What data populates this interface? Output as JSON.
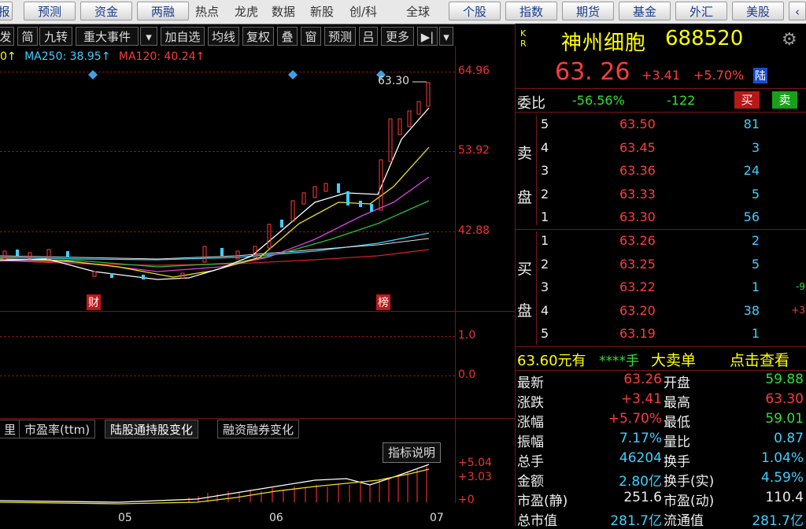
{
  "nav": {
    "left_buttons": [
      "报",
      "预测",
      "资金",
      "两融"
    ],
    "texts": [
      "热点",
      "龙虎",
      "数据",
      "新股",
      "创/科",
      "全球"
    ],
    "right_buttons": [
      "个股",
      "指数",
      "期货",
      "基金",
      "外汇",
      "美股"
    ]
  },
  "chart_toolbar": [
    "发",
    "简",
    "九转",
    "重大事件",
    "加自选",
    "均线",
    "复权",
    "叠",
    "窗",
    "预测",
    "吕",
    "更多"
  ],
  "ma_legend": {
    "prefix": "0↑",
    "ma250": "MA250: 38.95↑",
    "ma120": "MA120: 40.24↑"
  },
  "price_axis": [
    "64.96",
    "53.92",
    "42.88"
  ],
  "max_label": "63.30",
  "markers": {
    "cai": "财",
    "bang": "榜"
  },
  "indicator_axis": [
    "1.0",
    "0.0"
  ],
  "tabs": [
    "里",
    "市盈率(ttm)",
    "陆股通持股变化",
    "融资融券变化"
  ],
  "sub_button": "指标说明",
  "sub_axis": [
    "+5.04",
    "+3.03",
    "+0"
  ],
  "time_axis": [
    "05",
    "06",
    "07"
  ],
  "stock": {
    "kr": "K\nR",
    "name": "神州细胞",
    "code": "688520",
    "price": "63. 26",
    "change": "+3.41",
    "change_pct": "+5.70%",
    "lu": "陆"
  },
  "weibi": {
    "label": "委比",
    "pct": "-56.56%",
    "val": "-122",
    "buy_btn": "买",
    "sell_btn": "卖"
  },
  "sell_label": [
    "卖",
    "盘"
  ],
  "buy_label": [
    "买",
    "盘"
  ],
  "sell_orders": [
    {
      "lvl": "5",
      "price": "63.50",
      "vol": "81",
      "chg": ""
    },
    {
      "lvl": "4",
      "price": "63.45",
      "vol": "3",
      "chg": ""
    },
    {
      "lvl": "3",
      "price": "63.36",
      "vol": "24",
      "chg": ""
    },
    {
      "lvl": "2",
      "price": "63.33",
      "vol": "5",
      "chg": ""
    },
    {
      "lvl": "1",
      "price": "63.30",
      "vol": "56",
      "chg": ""
    }
  ],
  "buy_orders": [
    {
      "lvl": "1",
      "price": "63.26",
      "vol": "2",
      "chg": ""
    },
    {
      "lvl": "2",
      "price": "63.25",
      "vol": "5",
      "chg": ""
    },
    {
      "lvl": "3",
      "price": "63.22",
      "vol": "1",
      "chg": "-9"
    },
    {
      "lvl": "4",
      "price": "63.20",
      "vol": "38",
      "chg": "+3"
    },
    {
      "lvl": "5",
      "price": "63.19",
      "vol": "1",
      "chg": ""
    }
  ],
  "big_order": {
    "price": "63.60元有",
    "stars": "****手",
    "label": "大卖单",
    "link": "点击查看"
  },
  "stats": [
    {
      "l1": "最新",
      "v1": "63.26",
      "l2": "开盘",
      "v2": "59.88",
      "c1": "red",
      "c2": "grn"
    },
    {
      "l1": "涨跌",
      "v1": "+3.41",
      "l2": "最高",
      "v2": "63.30",
      "c1": "red",
      "c2": "red"
    },
    {
      "l1": "涨幅",
      "v1": "+5.70%",
      "l2": "最低",
      "v2": "59.01",
      "c1": "red",
      "c2": "grn"
    },
    {
      "l1": "振幅",
      "v1": "7.17%",
      "l2": "量比",
      "v2": "0.87",
      "c1": "cyan",
      "c2": "cyan"
    },
    {
      "l1": "总手",
      "v1": "46204",
      "l2": "换手",
      "v2": "1.04%",
      "c1": "cyan",
      "c2": "cyan"
    },
    {
      "l1": "金额",
      "v1": "2.80亿",
      "l2": "换手(实)",
      "v2": "4.59%",
      "c1": "cyan",
      "c2": "cyan"
    },
    {
      "l1": "市盈(静)",
      "v1": "251.6",
      "l2": "市盈(动)",
      "v2": "110.4",
      "c1": "wht",
      "c2": "wht"
    },
    {
      "l1": "总市值",
      "v1": "281.7亿",
      "l2": "流通值",
      "v2": "281.7亿",
      "c1": "cyan",
      "c2": "cyan"
    }
  ],
  "colors": {
    "up": "#ff3b3b",
    "down": "#2fe02f",
    "accent": "#3fd0ff",
    "grid": "#7a1515"
  }
}
